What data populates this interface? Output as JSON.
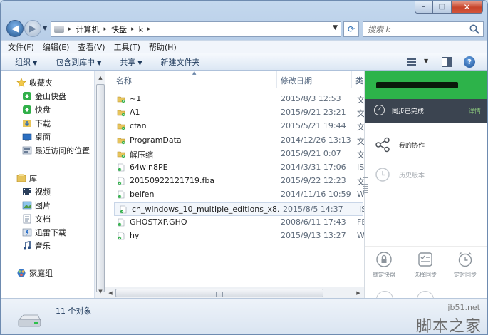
{
  "caption": {
    "minimize": "–",
    "maximize": "□",
    "close": "✕"
  },
  "address": {
    "crumbs": [
      "计算机",
      "快盘",
      "k"
    ]
  },
  "search": {
    "placeholder": "搜索 k"
  },
  "menu": [
    "文件(F)",
    "编辑(E)",
    "查看(V)",
    "工具(T)",
    "帮助(H)"
  ],
  "commands": [
    {
      "label": "组织",
      "dropdown": true
    },
    {
      "label": "包含到库中",
      "dropdown": true
    },
    {
      "label": "共享",
      "dropdown": true
    },
    {
      "label": "新建文件夹",
      "dropdown": false
    }
  ],
  "navpane": {
    "favorites": {
      "label": "收藏夹",
      "items": [
        "金山快盘",
        "快盘",
        "下载",
        "桌面",
        "最近访问的位置"
      ]
    },
    "libraries": {
      "label": "库",
      "items": [
        "视频",
        "图片",
        "文档",
        "迅雷下载",
        "音乐"
      ]
    },
    "homegroup": {
      "label": "家庭组"
    }
  },
  "columns": {
    "name": "名称",
    "date": "修改日期",
    "type": "类"
  },
  "files": [
    {
      "name": "~1",
      "date": "2015/8/3 12:53",
      "type": "文",
      "kind": "folder"
    },
    {
      "name": "A1",
      "date": "2015/9/21 23:21",
      "type": "文",
      "kind": "folder"
    },
    {
      "name": "cfan",
      "date": "2015/5/21 19:44",
      "type": "文",
      "kind": "folder"
    },
    {
      "name": "ProgramData",
      "date": "2014/12/26 13:13",
      "type": "文",
      "kind": "folder"
    },
    {
      "name": "解压缩",
      "date": "2015/9/21 0:07",
      "type": "文",
      "kind": "folder"
    },
    {
      "name": "64win8PE",
      "date": "2014/3/31 17:06",
      "type": "IS",
      "kind": "file"
    },
    {
      "name": "20150922121719.fba",
      "date": "2015/9/22 12:23",
      "type": "文",
      "kind": "file"
    },
    {
      "name": "beifen",
      "date": "2014/11/16 10:59",
      "type": "W",
      "kind": "file"
    },
    {
      "name": "cn_windows_10_multiple_editions_x8...",
      "date": "2015/8/5 14:37",
      "type": "IS",
      "kind": "file",
      "selected": true
    },
    {
      "name": "GHOSTXP.GHO",
      "date": "2008/6/11 17:43",
      "type": "FE",
      "kind": "file"
    },
    {
      "name": "hy",
      "date": "2015/9/13 13:27",
      "type": "W",
      "kind": "file"
    }
  ],
  "sync": {
    "status": "同步已完成",
    "detail": "详情",
    "collab": "我的协作",
    "history": "历史版本",
    "tools": [
      "锁定快盘",
      "选择同步",
      "定时同步"
    ],
    "accent": "#2db34a"
  },
  "status": {
    "count": "11 个对象"
  },
  "watermark": {
    "url": "jb51.net",
    "text": "脚本之家"
  }
}
